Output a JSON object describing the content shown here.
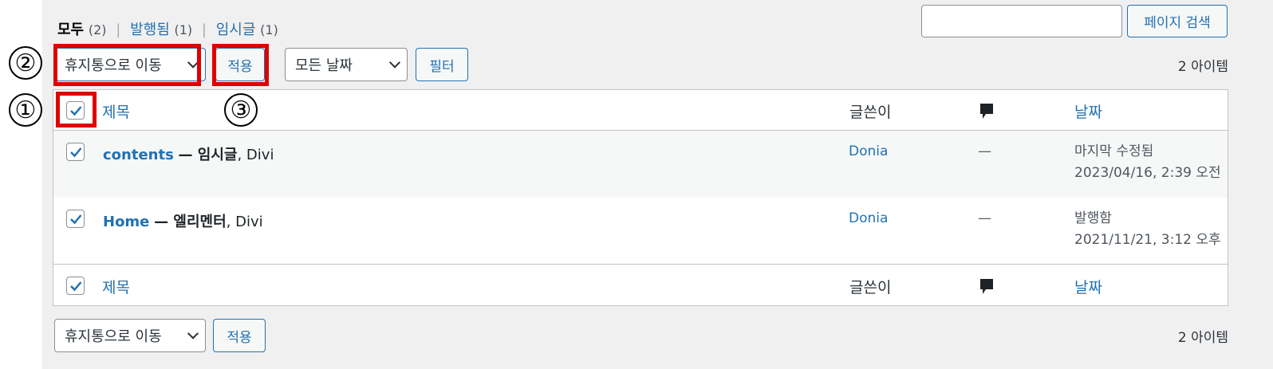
{
  "status_links": {
    "all_label": "모두",
    "all_count": "(2)",
    "published_label": "발행됨",
    "published_count": "(1)",
    "draft_label": "임시글",
    "draft_count": "(1)",
    "separator": "|"
  },
  "search": {
    "value": "",
    "button_label": "페이지 검색"
  },
  "top_nav": {
    "bulk_action_selected": "휴지통으로 이동",
    "apply_label": "적용",
    "date_filter_selected": "모든 날짜",
    "filter_label": "필터",
    "items_count": "2 아이템"
  },
  "table": {
    "columns": {
      "title": "제목",
      "author": "글쓴이",
      "comments_icon": "comment-bubble-icon",
      "date": "날짜"
    },
    "rows": [
      {
        "checked": true,
        "title": "contents",
        "state": "— 임시글",
        "suffix": ", Divi",
        "author": "Donia",
        "comments": "—",
        "date_status": "마지막 수정됨",
        "date_value": "2023/04/16, 2:39 오전"
      },
      {
        "checked": true,
        "title": "Home",
        "state": "— 엘리멘터",
        "suffix": ", Divi",
        "author": "Donia",
        "comments": "—",
        "date_status": "발행함",
        "date_value": "2021/11/21, 3:12 오후"
      }
    ]
  },
  "bottom_nav": {
    "bulk_action_selected": "휴지통으로 이동",
    "apply_label": "적용",
    "items_count": "2 아이템"
  },
  "annotations": {
    "step1": "①",
    "step2": "②",
    "step3": "③",
    "highlight_color": "#e00000"
  },
  "colors": {
    "link": "#2271b1",
    "background": "#f0f0f1"
  }
}
